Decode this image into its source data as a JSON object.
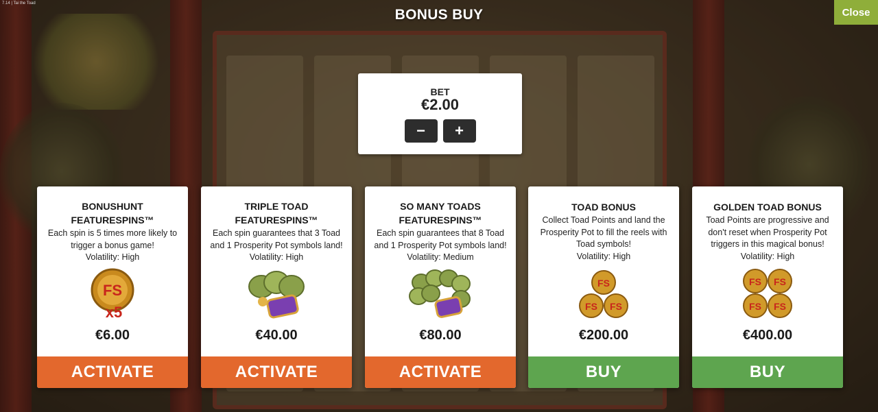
{
  "header": {
    "version": "7.14 | Tai the Toad",
    "title": "BONUS BUY",
    "close_label": "Close"
  },
  "bet": {
    "label": "BET",
    "value": "€2.00",
    "decrease_label": "−",
    "increase_label": "+"
  },
  "cards": [
    {
      "title_line1": "BONUSHUNT",
      "title_line2": "FEATURESPINS™",
      "desc_lines": [
        "Each spin is 5 times more likely to",
        "trigger a bonus game!",
        "Volatility: High"
      ],
      "price": "€6.00",
      "action": "ACTIVATE",
      "icon": "fs-x5-coin-icon"
    },
    {
      "title_line1": "TRIPLE TOAD",
      "title_line2": "FEATURESPINS™",
      "desc_lines": [
        "Each spin guarantees that 3 Toad",
        "and 1 Prosperity Pot symbols land!",
        "Volatility: High"
      ],
      "price": "€40.00",
      "action": "ACTIVATE",
      "icon": "three-toads-pot-icon"
    },
    {
      "title_line1": "SO MANY TOADS",
      "title_line2": "FEATURESPINS™",
      "desc_lines": [
        "Each spin guarantees that 8 Toad",
        "and 1 Prosperity Pot symbols land!",
        "Volatility: Medium"
      ],
      "price": "€80.00",
      "action": "ACTIVATE",
      "icon": "many-toads-pot-icon"
    },
    {
      "title_line1": "TOAD BONUS",
      "desc_lines": [
        "Collect Toad Points and land the",
        "Prosperity Pot to fill the reels with",
        "Toad symbols!",
        "Volatility: High"
      ],
      "price": "€200.00",
      "action": "BUY",
      "icon": "three-fs-coins-icon"
    },
    {
      "title_line1": "GOLDEN TOAD BONUS",
      "desc_lines": [
        "Toad Points are progressive and",
        "don't reset when Prosperity Pot",
        "triggers in this magical bonus!",
        "Volatility: High"
      ],
      "price": "€400.00",
      "action": "BUY",
      "icon": "four-fs-coins-icon"
    }
  ],
  "colors": {
    "activate": "#e3682d",
    "buy": "#5ea54f",
    "close": "#8fae3a"
  }
}
